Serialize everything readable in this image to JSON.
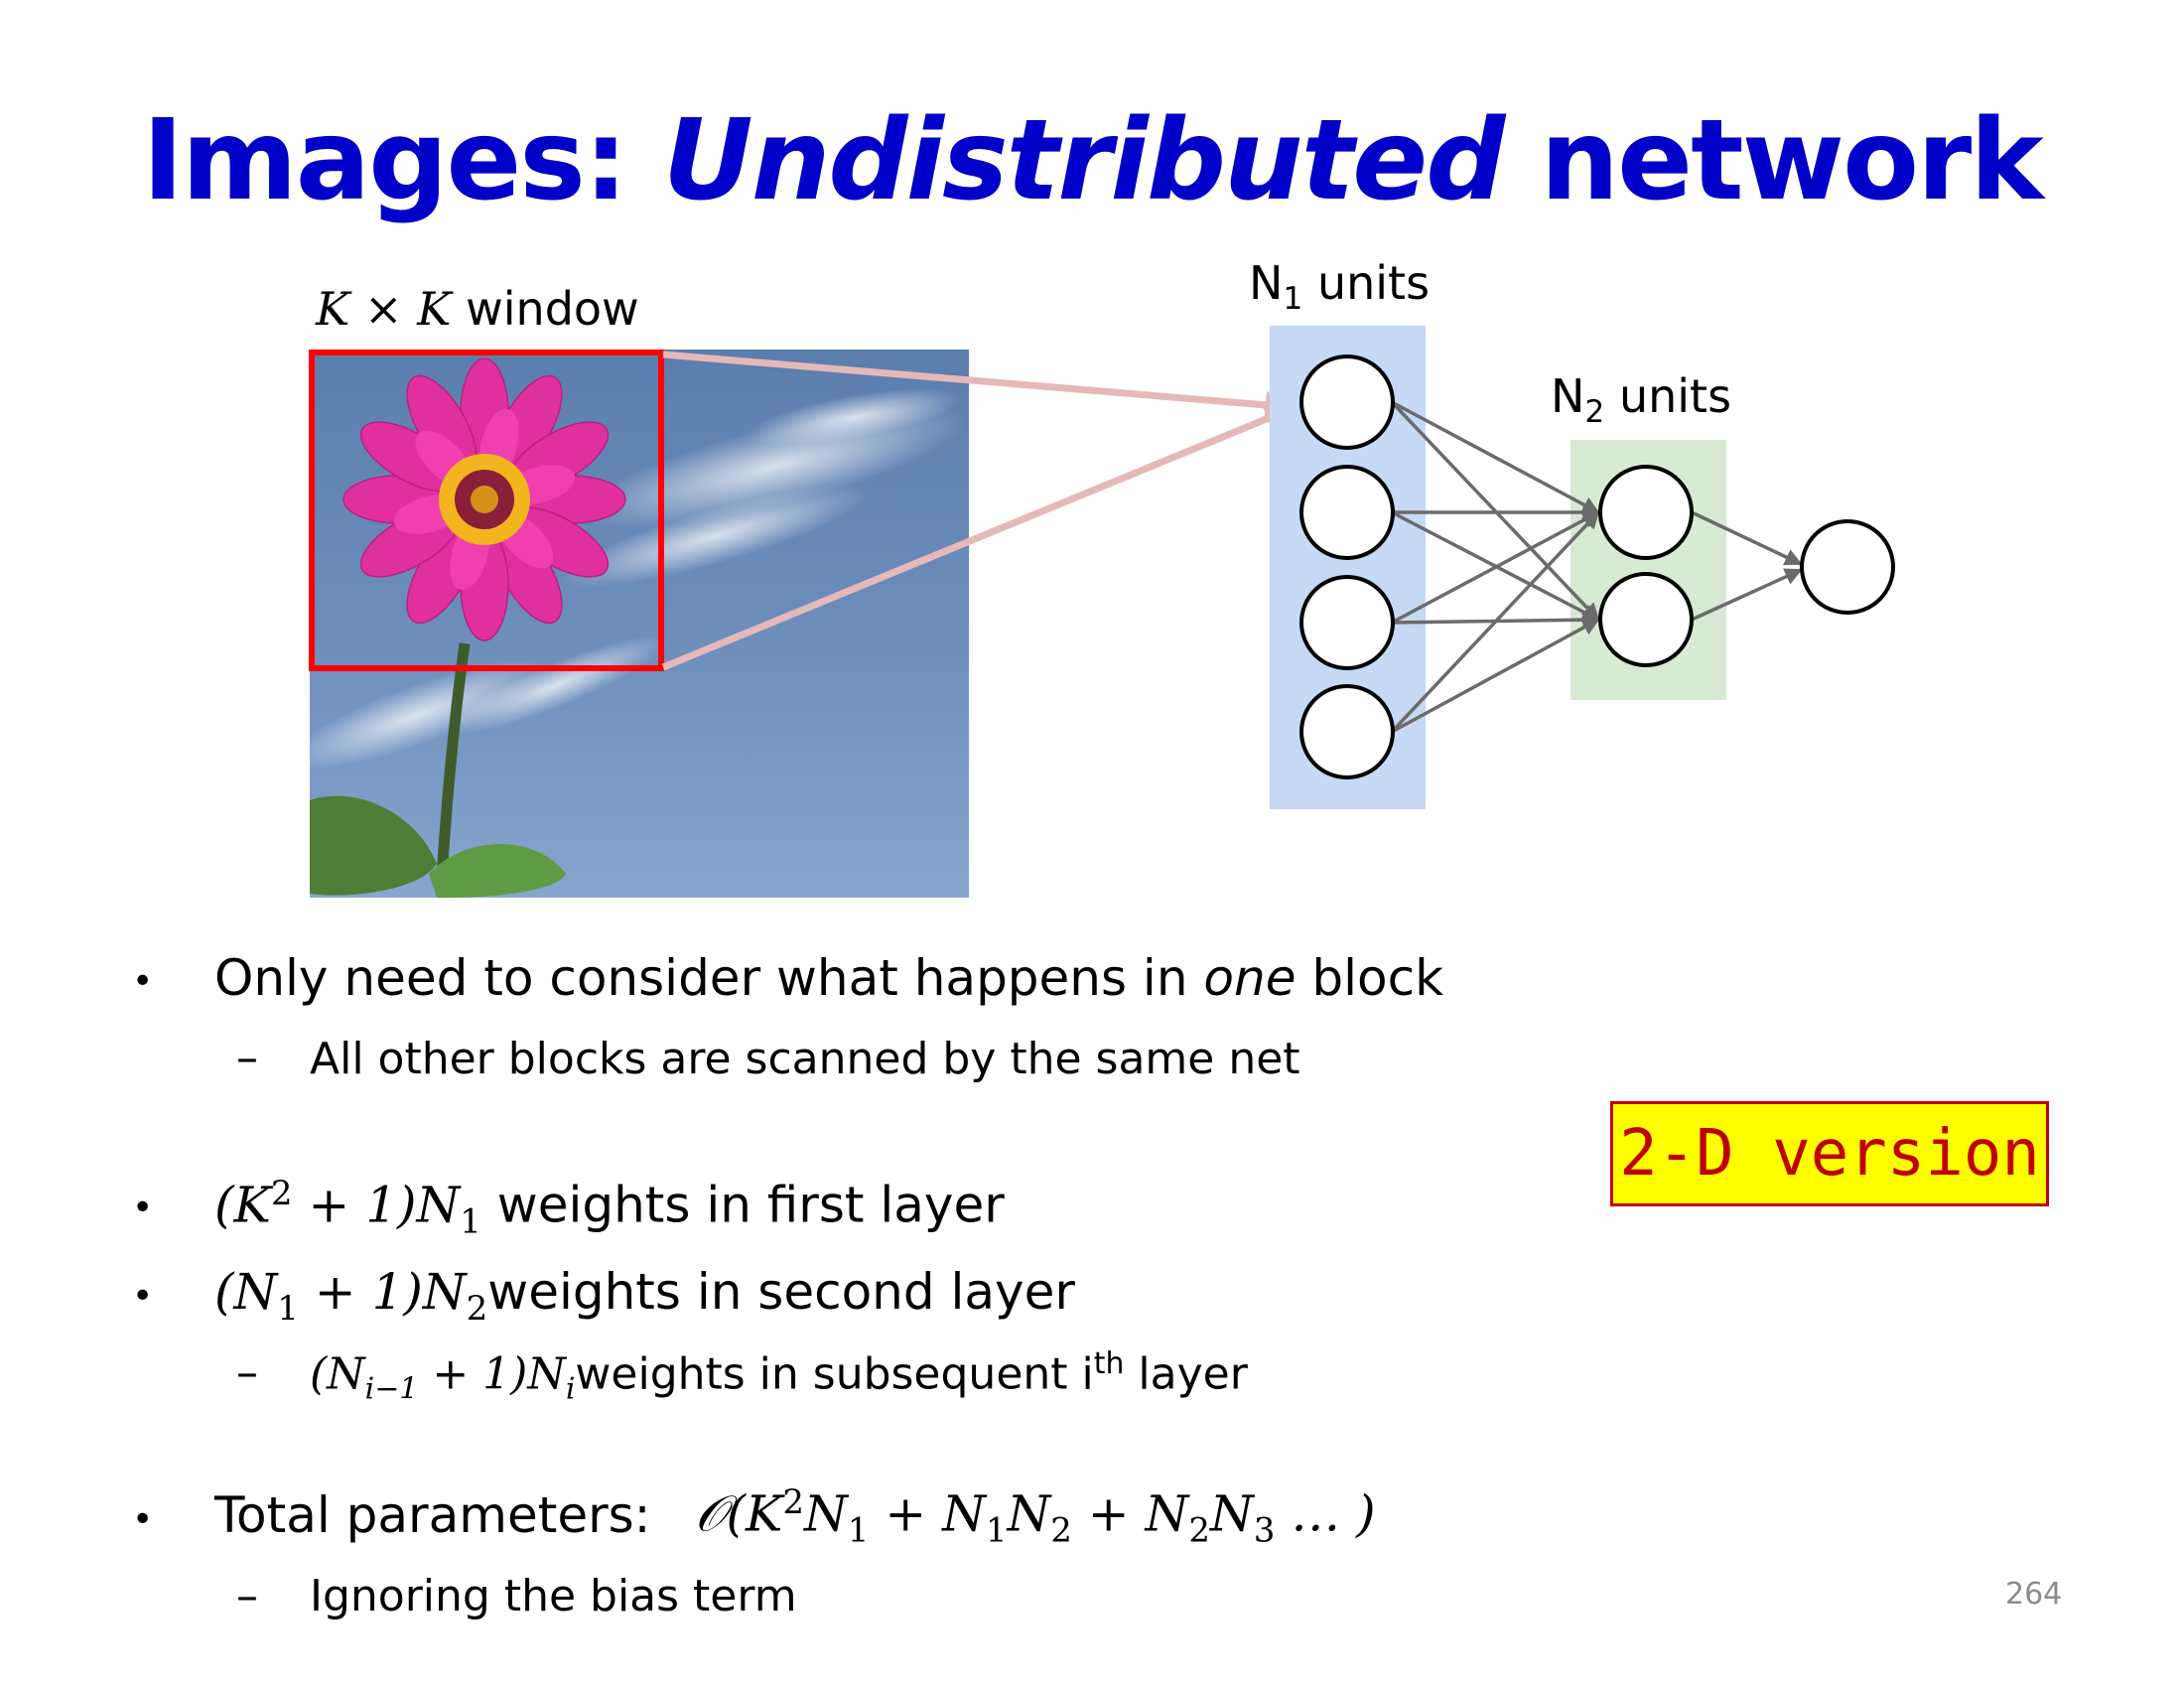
{
  "slide": {
    "title_part1": "Images: ",
    "title_part2": "Undistributed",
    "title_part3": " network",
    "window_label_math": "K × K",
    "window_label_text": " window",
    "n1_label_N": "N",
    "n1_label_sub": "1",
    "n1_label_text": " units",
    "n2_label_N": "N",
    "n2_label_sub": "2",
    "n2_label_text": " units",
    "badge": "2-D version",
    "page_number": "264"
  },
  "bullets": {
    "b1_text_a": "Only need to consider what happens in ",
    "b1_text_em": "one",
    "b1_text_b": " block",
    "b1_sub": "All other blocks are scanned by the same net",
    "b2_math_a": "(K",
    "b2_math_sup": "2",
    "b2_math_b": " + 1)N",
    "b2_math_sub": "1",
    "b2_text": " weights in first layer",
    "b3_math_a": "(N",
    "b3_math_sub1": "1",
    "b3_math_b": " + 1)N",
    "b3_math_sub2": "2",
    "b3_text": "weights in second layer",
    "b3_sub_math_a": "(N",
    "b3_sub_math_sub1": "i−1",
    "b3_sub_math_b": " + 1)N",
    "b3_sub_math_sub2": "i",
    "b3_sub_text_a": "weights in subsequent i",
    "b3_sub_sup": "th",
    "b3_sub_text_b": " layer",
    "b4_text": "Total parameters:",
    "b4_math_a": "𝒪(K",
    "b4_math_sup": "2",
    "b4_math_b": "N",
    "b4_math_s1": "1",
    "b4_math_c": " + N",
    "b4_math_s2": "1",
    "b4_math_d": "N",
    "b4_math_s3": "2",
    "b4_math_e": " + N",
    "b4_math_s4": "2",
    "b4_math_f": "N",
    "b4_math_s5": "3",
    "b4_math_g": " … )",
    "b4_sub": "Ignoring the bias term"
  },
  "colors": {
    "title": "#0000c8",
    "layer1_bg": "#c6d9f5",
    "layer2_bg": "#d8ead3",
    "window_border": "#ff0000",
    "projection_arrow": "#e6b8b8",
    "edges": "#6b6b6b",
    "badge_bg": "#ffff00",
    "badge_text": "#c00000"
  },
  "icons": {
    "bullet": "•",
    "dash": "–"
  }
}
